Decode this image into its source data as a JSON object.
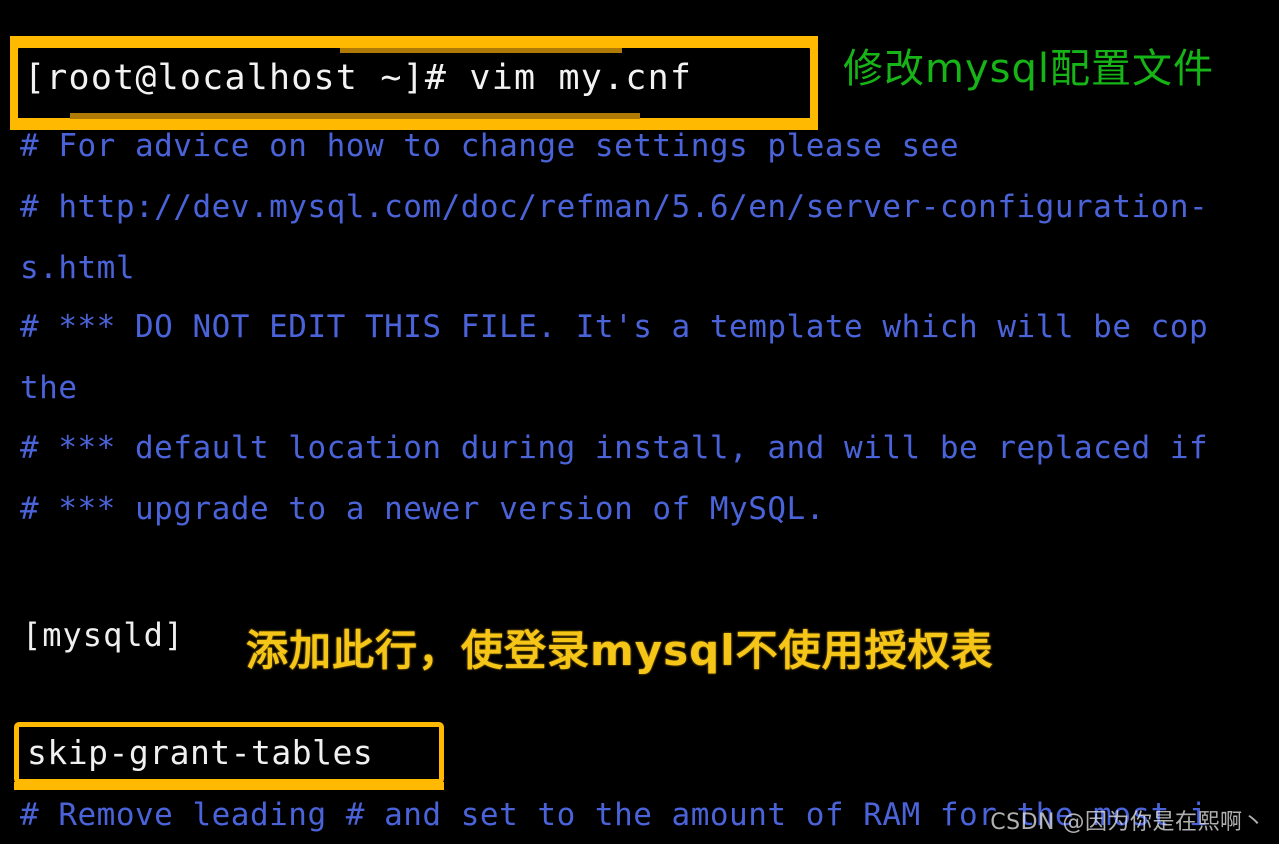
{
  "terminal": {
    "prompt": "[root@localhost ~]# vim my.cnf",
    "mysqld_section": "[mysqld]",
    "added_directive": "skip-grant-tables",
    "lines": [
      "# For advice on how to change settings please see",
      "# http://dev.mysql.com/doc/refman/5.6/en/server-configuration-",
      "s.html",
      "# *** DO NOT EDIT THIS FILE. It's a template which will be cop",
      "the",
      "# *** default location during install, and will be replaced if",
      "# *** upgrade to a newer version of MySQL.",
      "# Remove leading # and set to the amount of RAM for the most i"
    ]
  },
  "annotations": {
    "green_note": "修改mysql配置文件",
    "yellow_note": "添加此行，使登录mysql不使用授权表"
  },
  "watermark": {
    "text": "CSDN @因为你是在熙啊丶"
  },
  "colors": {
    "background": "#000000",
    "comment_text": "#4a63d8",
    "plain_text": "#efefef",
    "highlight_box": "#ffb900",
    "green_annotation": "#16b416",
    "yellow_annotation": "#f5c518"
  }
}
